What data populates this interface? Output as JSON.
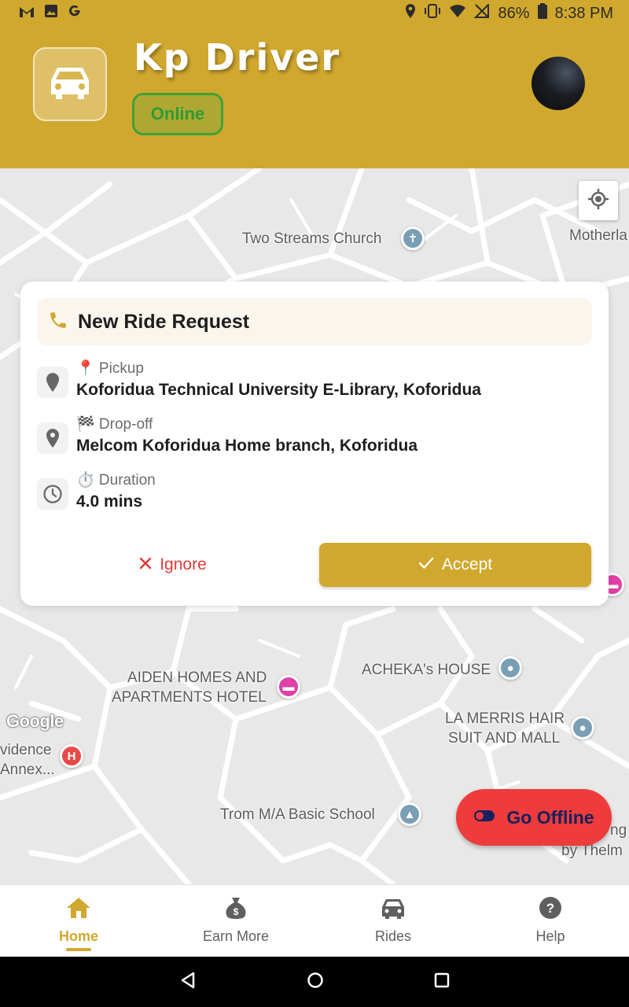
{
  "status_bar": {
    "battery": "86%",
    "time": "8:38 PM"
  },
  "header": {
    "app_title": "Kp Driver",
    "status_badge": "Online"
  },
  "map": {
    "labels": {
      "church": "Two Streams Church",
      "motherland": "Motherla",
      "aiden_line1": "AIDEN HOMES AND",
      "aiden_line2": "APARTMENTS HOTEL",
      "acheka": "ACHEKA's HOUSE",
      "lamerris_line1": "LA MERRIS HAIR",
      "lamerris_line2": "SUIT AND MALL",
      "providence_line1": "vidence",
      "providence_line2": "Annex...",
      "trom": "Trom M/A Basic School",
      "thelma_line1": "ng",
      "thelma_line2": "by Thelm",
      "google": "Google"
    },
    "hospital_glyph": "H"
  },
  "ride_request": {
    "title": "New Ride Request",
    "pickup_label": "📍 Pickup",
    "pickup_value": "Koforidua Technical University E-Library, Koforidua",
    "dropoff_label": "🏁 Drop-off",
    "dropoff_value": "Melcom Koforidua Home branch, Koforidua",
    "duration_label": "⏱️ Duration",
    "duration_value": "4.0 mins",
    "ignore_label": "Ignore",
    "accept_label": "Accept"
  },
  "offline_button": {
    "label": "Go Offline"
  },
  "bottom_nav": {
    "items": [
      {
        "label": "Home",
        "icon": "home-icon",
        "active": true
      },
      {
        "label": "Earn More",
        "icon": "money-bag-icon",
        "active": false
      },
      {
        "label": "Rides",
        "icon": "car-icon",
        "active": false
      },
      {
        "label": "Help",
        "icon": "help-icon",
        "active": false
      }
    ]
  },
  "colors": {
    "brand": "#d1a82e",
    "online_green": "#2e9b35",
    "danger": "#ef3b3b",
    "offline_text": "#15215c"
  }
}
